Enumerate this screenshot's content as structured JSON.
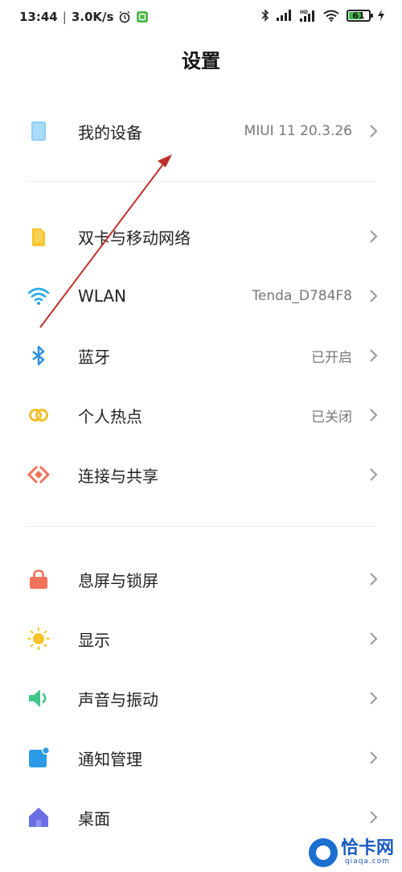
{
  "status_bar": {
    "time": "13:44",
    "net_speed": "3.0K/s",
    "battery_level": "61"
  },
  "header": {
    "title": "设置"
  },
  "sections": [
    [
      {
        "name": "my-device",
        "icon": "device-icon",
        "label": "我的设备",
        "value": "MIUI 11 20.3.26"
      }
    ],
    [
      {
        "name": "sim-network",
        "icon": "sim-card-icon",
        "label": "双卡与移动网络",
        "value": ""
      },
      {
        "name": "wlan",
        "icon": "wifi-icon",
        "label": "WLAN",
        "value": "Tenda_D784F8"
      },
      {
        "name": "bluetooth",
        "icon": "bluetooth-icon",
        "label": "蓝牙",
        "value": "已开启"
      },
      {
        "name": "hotspot",
        "icon": "hotspot-icon",
        "label": "个人热点",
        "value": "已关闭"
      },
      {
        "name": "connection-sharing",
        "icon": "share-icon",
        "label": "连接与共享",
        "value": ""
      }
    ],
    [
      {
        "name": "lock-screen",
        "icon": "lock-icon",
        "label": "息屏与锁屏",
        "value": ""
      },
      {
        "name": "display",
        "icon": "sun-icon",
        "label": "显示",
        "value": ""
      },
      {
        "name": "sound",
        "icon": "speaker-icon",
        "label": "声音与振动",
        "value": ""
      },
      {
        "name": "notifications",
        "icon": "notification-icon",
        "label": "通知管理",
        "value": ""
      },
      {
        "name": "home-screen",
        "icon": "home-icon",
        "label": "桌面",
        "value": ""
      }
    ]
  ],
  "watermark": {
    "title": "恰卡网",
    "url": "qiaqa.com"
  },
  "colors": {
    "device": "#8fd0f5",
    "sim": "#f7c52b",
    "wifi": "#27a9e6",
    "bluetooth": "#2e8fe0",
    "hotspot": "#f2c12e",
    "share": "#f0735a",
    "lock": "#f0735a",
    "sun": "#f7c52b",
    "speaker": "#3fc78a",
    "notification": "#2b9be8",
    "home": "#6a6fe6",
    "annotation_arrow": "#c0302b"
  }
}
